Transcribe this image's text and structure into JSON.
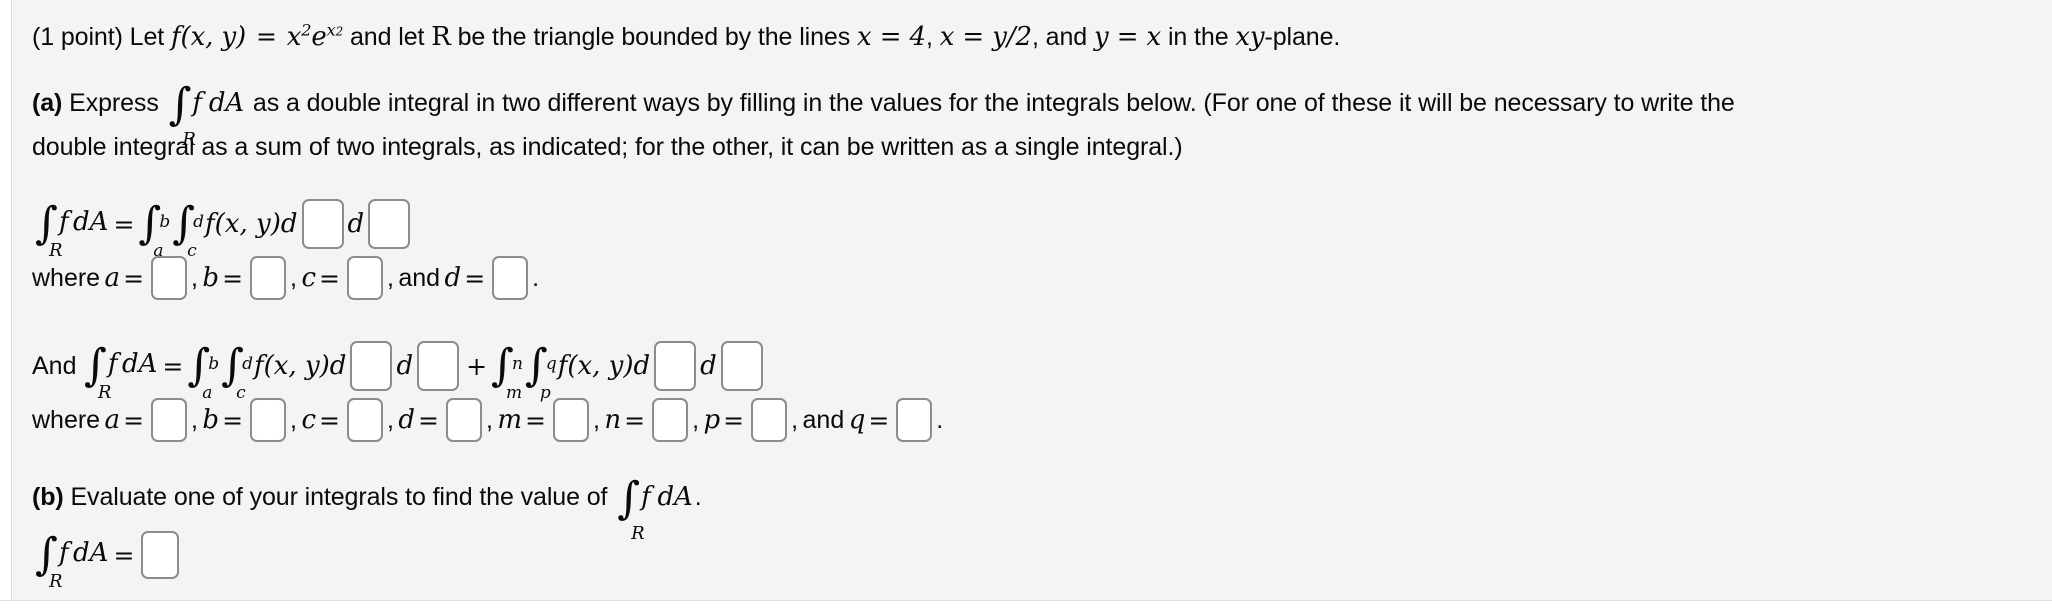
{
  "problem": {
    "points_label": "(1 point)",
    "intro": {
      "before_f": "Let",
      "f_name": "f",
      "f_args": "(x, y)",
      "equals": "=",
      "f_body_base": "x",
      "f_body_exp": "2",
      "f_body_e": "e",
      "f_body_e_exp": "x",
      "f_body_e_exp2": "2",
      "after_f": "and let",
      "region": "R",
      "mid": "be the triangle bounded by the lines",
      "line1": "x = 4",
      "line2": "x = y/2",
      "line3": "y = x",
      "tail": "in the xy-plane.",
      "full_text": "(1 point) Let f(x, y) = x² e^{x²} and let R be the triangle bounded by the lines x = 4, x = y/2, and y = x in the xy-plane."
    },
    "part_a": {
      "marker": "(a)",
      "text_1": "Express",
      "integral_label": "∫_R f dA",
      "text_2": "as a double integral in two different ways by filling in the values for the integrals below. (For one of these it will be necessary to write the",
      "text_3": "double integral as a sum of two integrals, as indicated; for the other, it can be written as a single integral.)"
    },
    "equation_1": {
      "lhs_integral": "∫_R f dA",
      "equals": "=",
      "outer_lower": "a",
      "outer_upper": "b",
      "inner_lower": "c",
      "inner_upper": "d",
      "integrand": "f(x, y)",
      "d_first": "d",
      "d_second": "d",
      "box_1_value": "",
      "box_2_value": ""
    },
    "where_1": {
      "prefix": "where",
      "vars": [
        {
          "name": "a",
          "equals": "=",
          "value": "",
          "separator": ","
        },
        {
          "name": "b",
          "equals": "=",
          "value": "",
          "separator": ","
        },
        {
          "name": "c",
          "equals": "=",
          "value": "",
          "separator": ","
        },
        {
          "name": "d",
          "equals": "=",
          "value": "",
          "separator": ".",
          "prefix": "and"
        }
      ],
      "and_label": "and"
    },
    "equation_2": {
      "and_prefix": "And",
      "lhs_integral": "∫_R f dA",
      "equals": "=",
      "term1": {
        "outer_lower": "a",
        "outer_upper": "b",
        "inner_lower": "c",
        "inner_upper": "d",
        "integrand": "f(x, y)",
        "d_first": "d",
        "d_second": "d",
        "box_1_value": "",
        "box_2_value": ""
      },
      "plus": "+",
      "term2": {
        "outer_lower": "m",
        "outer_upper": "n",
        "inner_lower": "p",
        "inner_upper": "q",
        "integrand": "f(x, y)",
        "d_first": "d",
        "d_second": "d",
        "box_1_value": "",
        "box_2_value": ""
      }
    },
    "where_2": {
      "prefix": "where",
      "vars": [
        {
          "name": "a",
          "equals": "=",
          "value": "",
          "separator": ","
        },
        {
          "name": "b",
          "equals": "=",
          "value": "",
          "separator": ","
        },
        {
          "name": "c",
          "equals": "=",
          "value": "",
          "separator": ","
        },
        {
          "name": "d",
          "equals": "=",
          "value": "",
          "separator": ","
        },
        {
          "name": "m",
          "equals": "=",
          "value": "",
          "separator": ","
        },
        {
          "name": "n",
          "equals": "=",
          "value": "",
          "separator": ","
        },
        {
          "name": "p",
          "equals": "=",
          "value": "",
          "separator": ","
        },
        {
          "name": "q",
          "equals": "=",
          "value": "",
          "separator": ".",
          "prefix": "and"
        }
      ],
      "and_label": "and"
    },
    "part_b": {
      "marker": "(b)",
      "text_1": "Evaluate one of your integrals to find the value of",
      "integral_label": "∫_R f dA",
      "period": ".",
      "answer_equals": "=",
      "answer_value": ""
    }
  },
  "colors": {
    "page_background": "#f4f4f4",
    "text": "#0a0a0a",
    "input_border": "#8c8c8c",
    "input_background": "#ffffff",
    "rule": "#ffffff"
  }
}
